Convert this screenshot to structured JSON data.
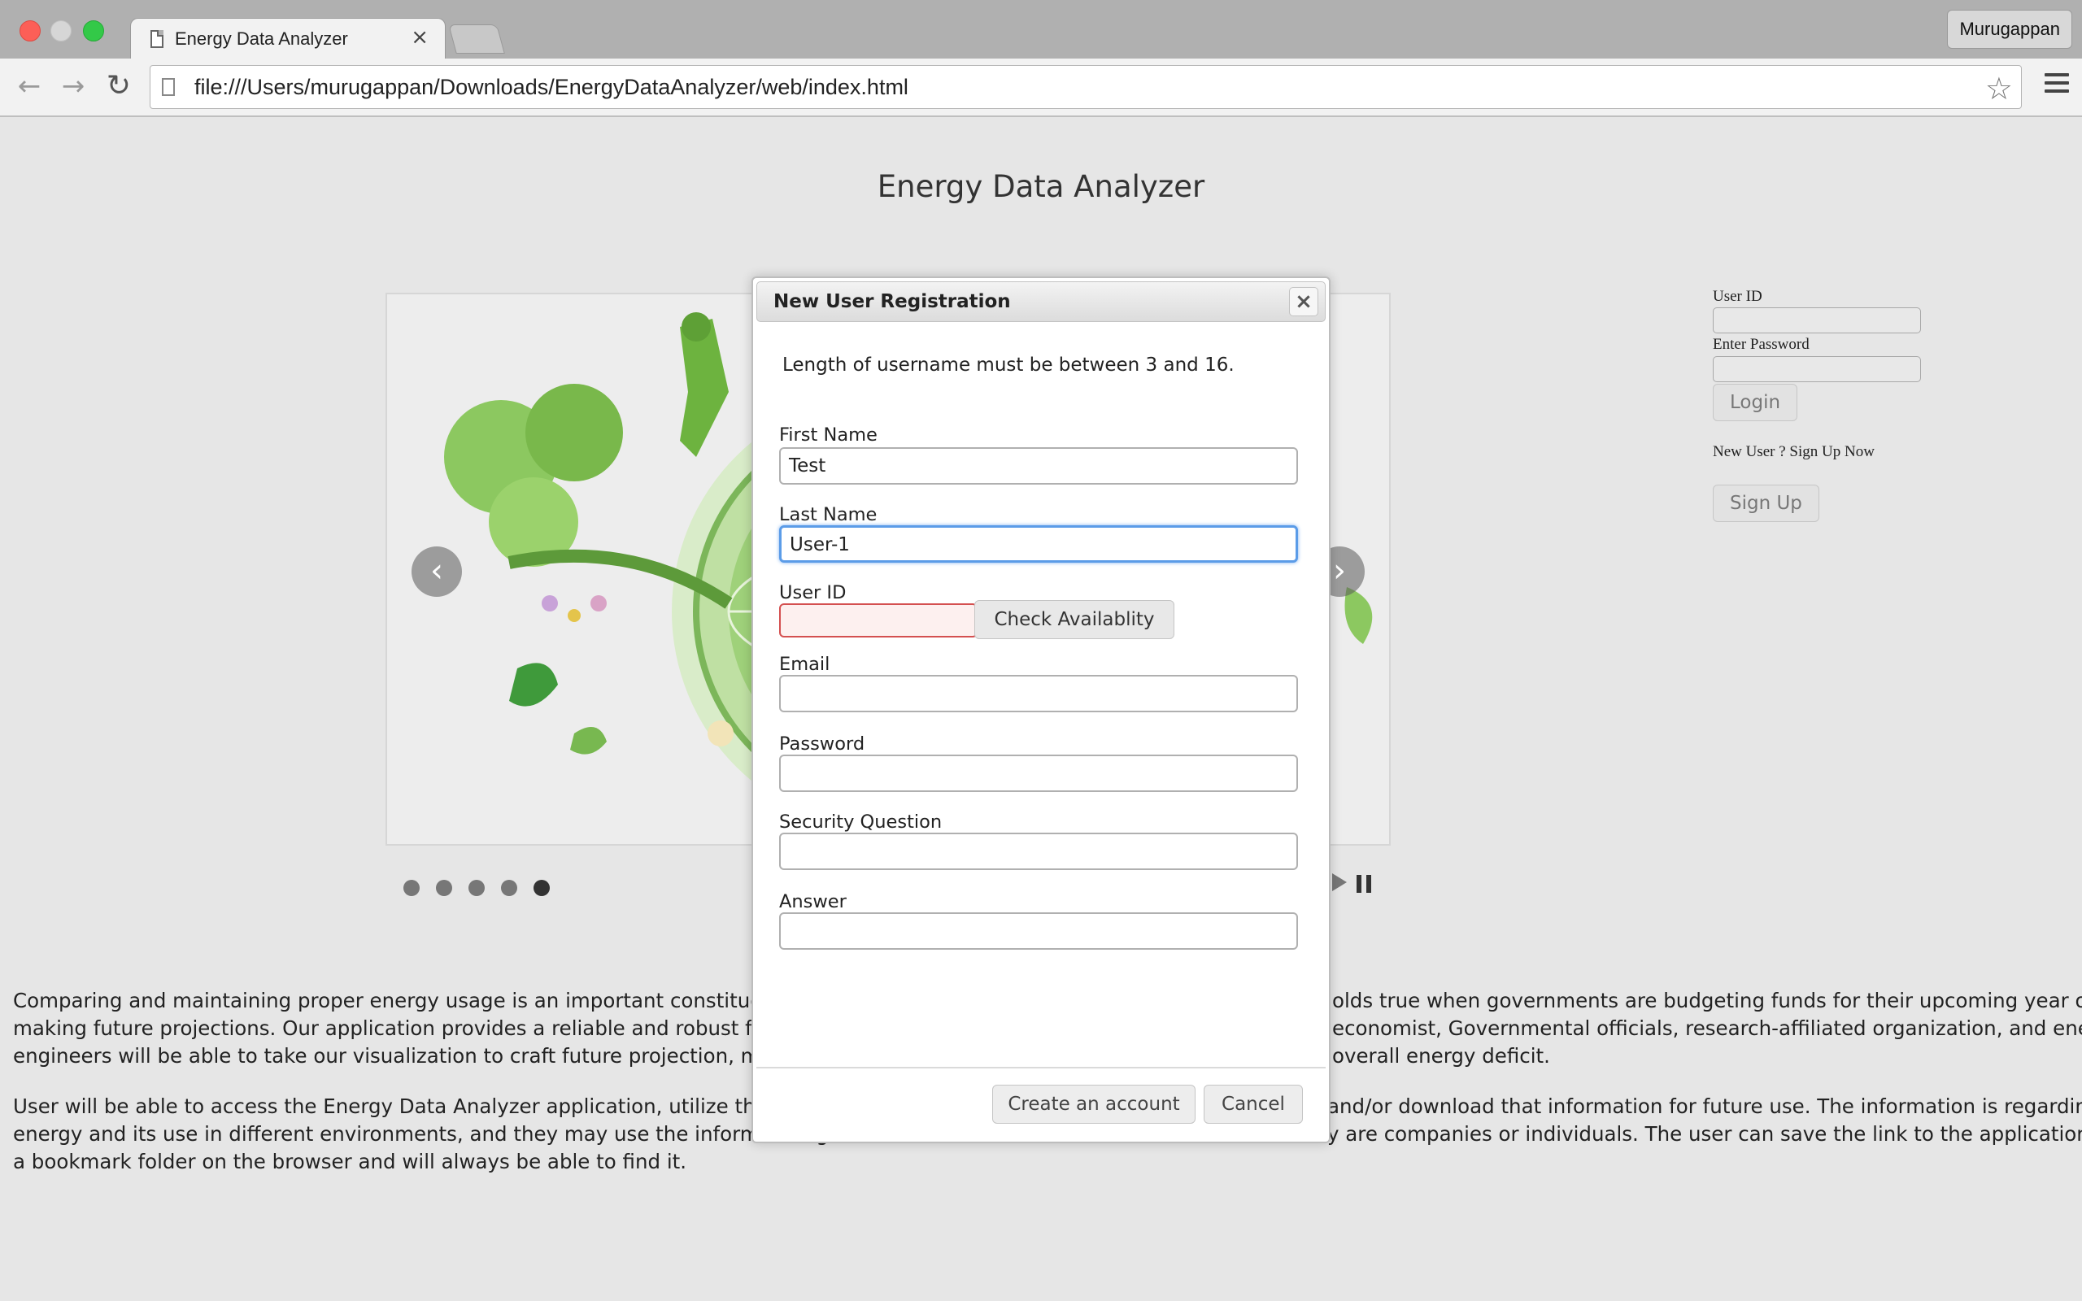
{
  "browser": {
    "tab_title": "Energy Data Analyzer",
    "tab_close": "×",
    "profile_name": "Murugappan",
    "url": "file:///Users/murugappan/Downloads/EnergyDataAnalyzer/web/index.html",
    "icons": [
      "page-icon",
      "back-arrow-icon",
      "forward-arrow-icon",
      "reload-icon",
      "star-icon",
      "hamburger-menu-icon"
    ]
  },
  "page": {
    "title": "Energy Data Analyzer",
    "slider": {
      "prev_glyph": "‹",
      "next_glyph": "›",
      "dot_count": 5,
      "active_dot": 5
    },
    "login": {
      "userid_label": "User ID",
      "password_label": "Enter Password",
      "login_button": "Login",
      "signup_prompt": "New User ? Sign Up Now",
      "signup_button": "Sign Up"
    },
    "paragraphs": [
      "Comparing and maintaining proper energy usage is an important constituent in t",
      "User will be able to access the Energy Data Analyzer application, utilize the tabs"
    ],
    "paragraph_lines": {
      "p1_left": [
        "Comparing and maintaining proper energy usage is an important constituent in t",
        "making future projections. Our application provides a reliable and robust founda",
        "engineers will be able to take our visualization to craft future projection, make c"
      ],
      "p1_right": [
        "olds true when governments are budgeting funds for their upcoming year or",
        "economist, Governmental officials, research-affiliated organization, and energy",
        "overall energy deficit."
      ],
      "p2_left": [
        "User will be able to access the Energy Data Analyzer application, utilize the tabs",
        "energy and its use in different environments, and they may use the information g",
        "a bookmark folder on the browser and will always be able to find it."
      ],
      "p2_right": [
        "and/or download that information for future use. The information is regarding",
        "y are companies or individuals. The user can save the link to the application into"
      ]
    }
  },
  "modal": {
    "title": "New User Registration",
    "close_glyph": "×",
    "validation_message": "Length of username must be between 3 and 16.",
    "fields": {
      "first_name": {
        "label": "First Name",
        "value": "Test"
      },
      "last_name": {
        "label": "Last Name",
        "value": "User-1"
      },
      "user_id": {
        "label": "User ID",
        "value": ""
      },
      "email": {
        "label": "Email",
        "value": ""
      },
      "password": {
        "label": "Password",
        "value": ""
      },
      "security_question": {
        "label": "Security Question",
        "value": ""
      },
      "answer": {
        "label": "Answer",
        "value": ""
      }
    },
    "check_button": "Check Availablity",
    "create_button": "Create an account",
    "cancel_button": "Cancel"
  },
  "colors": {
    "focus_border": "#5b9ce8",
    "error_border": "#d45050",
    "page_background": "#e6e6e6"
  }
}
